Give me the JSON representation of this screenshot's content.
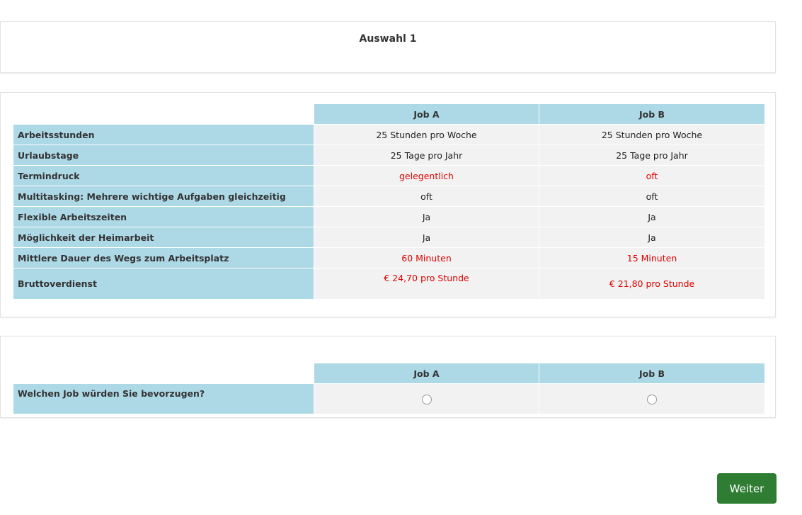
{
  "title": "Auswahl 1",
  "comparison": {
    "headers": [
      "Job A",
      "Job B"
    ],
    "rows": [
      {
        "label": "Arbeitsstunden",
        "a": "25 Stunden pro Woche",
        "b": "25 Stunden pro Woche",
        "a_highlight": false,
        "b_highlight": false
      },
      {
        "label": "Urlaubstage",
        "a": "25 Tage pro Jahr",
        "b": "25 Tage pro Jahr",
        "a_highlight": false,
        "b_highlight": false
      },
      {
        "label": "Termindruck",
        "a": "gelegentlich",
        "b": "oft",
        "a_highlight": true,
        "b_highlight": true
      },
      {
        "label": "Multitasking: Mehrere wichtige Aufgaben gleichzeitig",
        "a": "oft",
        "b": "oft",
        "a_highlight": false,
        "b_highlight": false
      },
      {
        "label": "Flexible Arbeitszeiten",
        "a": "Ja",
        "b": "Ja",
        "a_highlight": false,
        "b_highlight": false
      },
      {
        "label": "Möglichkeit der Heimarbeit",
        "a": "Ja",
        "b": "Ja",
        "a_highlight": false,
        "b_highlight": false
      },
      {
        "label": "Mittlere Dauer des Wegs zum Arbeitsplatz",
        "a": "60 Minuten",
        "b": "15 Minuten",
        "a_highlight": true,
        "b_highlight": true
      },
      {
        "label": "Bruttoverdienst",
        "a": "€ 24,70 pro Stunde",
        "b": "€ 21,80 pro Stunde",
        "a_highlight": true,
        "b_highlight": true
      }
    ],
    "highlight_color": "#e00000",
    "header_color": "#add8e6"
  },
  "question": {
    "headers": [
      "Job A",
      "Job B"
    ],
    "label": "Welchen Job würden Sie bevorzugen?",
    "selected": null
  },
  "next_button": {
    "label": "Weiter",
    "color": "#2e7d32"
  }
}
